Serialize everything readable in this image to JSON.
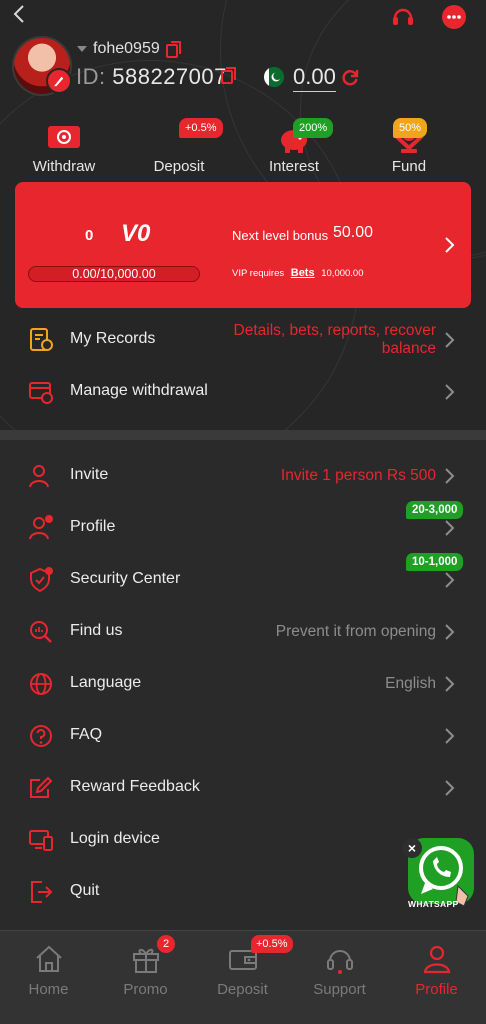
{
  "colors": {
    "accent": "#e8262e",
    "bonus_green": "#1fa024",
    "bg": "#2a2a2a"
  },
  "user": {
    "username": "fohe0959",
    "id_label": "ID:",
    "id_value": "588227007",
    "balance": "0.00"
  },
  "quick_actions": [
    {
      "label": "Withdraw",
      "icon": "withdraw-icon"
    },
    {
      "label": "Deposit",
      "icon": "deposit-icon",
      "badge": "+0.5%"
    },
    {
      "label": "Interest",
      "icon": "interest-icon",
      "badge": "200%"
    },
    {
      "label": "Fund",
      "icon": "fund-icon",
      "badge": "50%"
    }
  ],
  "vip": {
    "level_number": "0",
    "level_name": "V0",
    "progress_text": "0.00/10,000.00",
    "progress_fraction": 0,
    "next_bonus_label": "Next level bonus",
    "next_bonus_value": "50.00",
    "requires_prefix": "VIP requires",
    "requires_link": "Bets",
    "requires_value": "10,000.00"
  },
  "menu_top": [
    {
      "label": "My Records",
      "value": "Details, bets, reports, recover balance",
      "value_line1": "Details, bets, reports, recover",
      "value_line2": "balance",
      "icon": "records-icon"
    },
    {
      "label": "Manage withdrawal",
      "icon": "manage-withdrawal-icon"
    }
  ],
  "menu_main": [
    {
      "label": "Invite",
      "value": "Invite 1 person Rs 500",
      "icon": "invite-icon"
    },
    {
      "label": "Profile",
      "bonus": "20-3,000",
      "icon": "profile-icon"
    },
    {
      "label": "Security Center",
      "bonus": "10-1,000",
      "icon": "shield-icon"
    },
    {
      "label": "Find us",
      "value": "Prevent it from opening",
      "icon": "find-us-icon"
    },
    {
      "label": "Language",
      "value": "English",
      "icon": "globe-icon"
    },
    {
      "label": "FAQ",
      "icon": "question-icon"
    },
    {
      "label": "Reward Feedback",
      "icon": "feedback-icon"
    },
    {
      "label": "Login device",
      "icon": "device-icon"
    },
    {
      "label": "Quit",
      "icon": "logout-icon"
    }
  ],
  "whatsapp": {
    "label": "WHATSAPP",
    "close": "×"
  },
  "tabs": [
    {
      "label": "Home",
      "icon": "home-icon"
    },
    {
      "label": "Promo",
      "icon": "gift-icon",
      "badge": "2"
    },
    {
      "label": "Deposit",
      "icon": "wallet-icon",
      "badge": "+0.5%"
    },
    {
      "label": "Support",
      "icon": "headset-icon"
    },
    {
      "label": "Profile",
      "icon": "user-icon",
      "active": true
    }
  ]
}
